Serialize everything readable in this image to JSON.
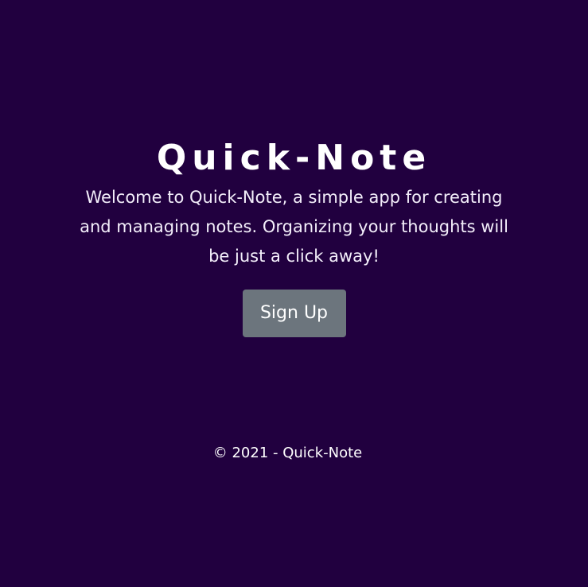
{
  "hero": {
    "title": "Quick-Note",
    "tagline": "Welcome to Quick-Note, a simple app for creating and managing notes. Organizing your thoughts will be just a click away!",
    "signup_label": "Sign Up"
  },
  "footer": {
    "copyright": "© 2021 - Quick-Note"
  },
  "colors": {
    "background": "#21003f",
    "button": "#6c757d",
    "text": "#ffffff"
  }
}
